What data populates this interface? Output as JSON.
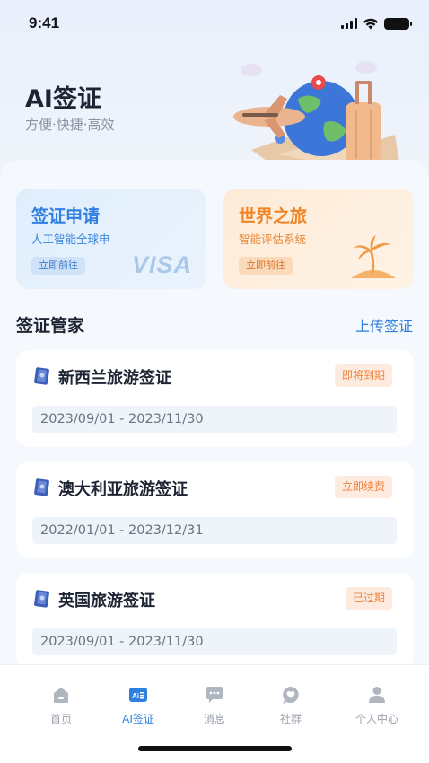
{
  "status_bar": {
    "time": "9:41"
  },
  "hero": {
    "title": "AI签证",
    "subtitle": "方便·快捷·高效"
  },
  "cards": [
    {
      "title": "签证申请",
      "subtitle": "人工智能全球申",
      "button": "立即前往",
      "logo_text": "VISA",
      "accent": "#2f7fe0"
    },
    {
      "title": "世界之旅",
      "subtitle": "智能评估系统",
      "button": "立即前往",
      "icon": "palm-island-icon",
      "accent": "#ef8526"
    }
  ],
  "section": {
    "title": "签证管家",
    "link": "上传签证"
  },
  "visas": [
    {
      "name": "新西兰旅游签证",
      "badge": "即将到期",
      "dates": "2023/09/01 - 2023/11/30"
    },
    {
      "name": "澳大利亚旅游签证",
      "badge": "立即续费",
      "dates": "2022/01/01 - 2023/12/31"
    },
    {
      "name": "英国旅游签证",
      "badge": "已过期",
      "dates": "2023/09/01 - 2023/11/30"
    }
  ],
  "tabs": [
    {
      "label": "首页",
      "icon": "home-icon"
    },
    {
      "label": "AI签证",
      "icon": "ai-visa-icon",
      "active": true
    },
    {
      "label": "消息",
      "icon": "message-icon"
    },
    {
      "label": "社群",
      "icon": "community-icon"
    },
    {
      "label": "个人中心",
      "icon": "profile-icon"
    }
  ],
  "colors": {
    "primary": "#2f7fe0",
    "orange": "#ef8526",
    "badge_text": "#f07f3a",
    "badge_bg": "#fdebe0"
  }
}
